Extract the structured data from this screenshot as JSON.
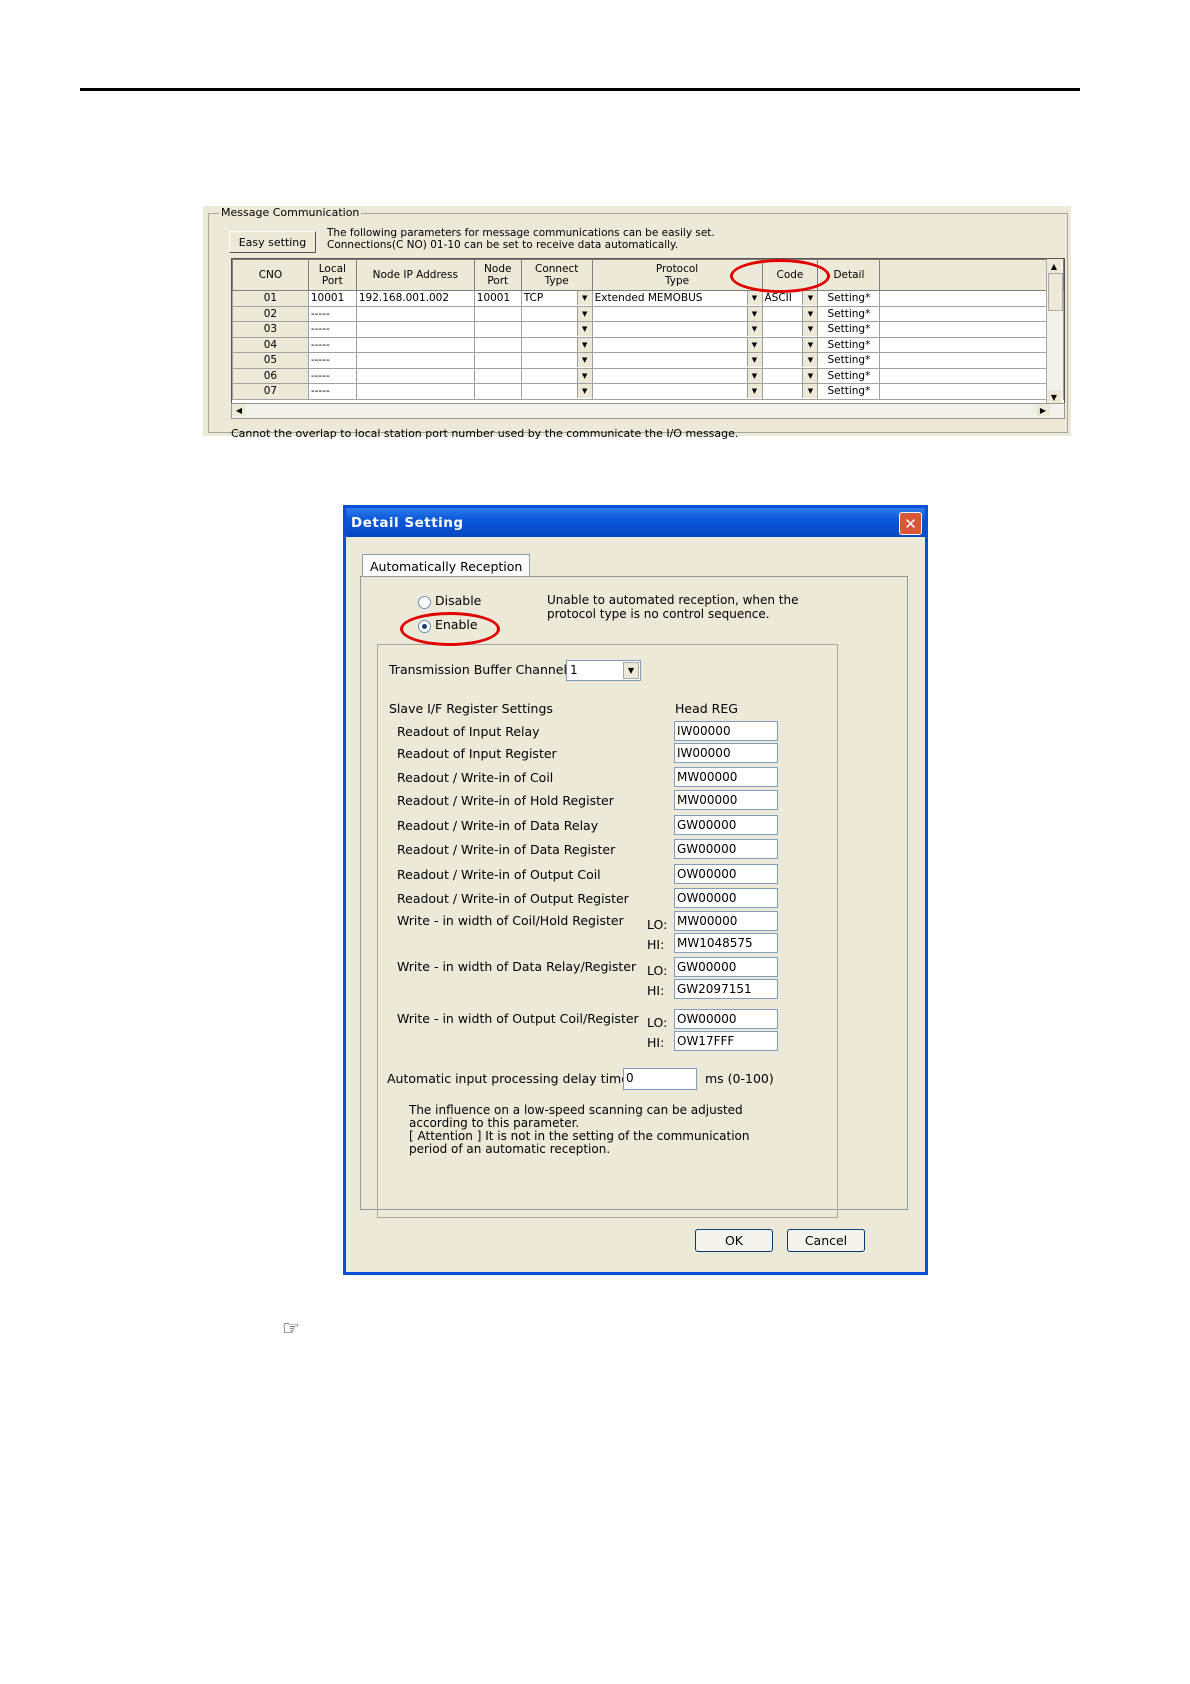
{
  "message_communication": {
    "group_title": "Message Communication",
    "easy_setting_label": "Easy setting",
    "info_line1": "The following parameters for message communications can be easily set.",
    "info_line2": "Connections(C NO) 01-10 can be set to receive data automatically.",
    "columns": [
      "CNO",
      "Local\nPort",
      "Node IP Address",
      "Node\nPort",
      "Connect\nType",
      "Protocol\nType",
      "Code",
      "Detail"
    ],
    "rows": [
      {
        "cno": "01",
        "local_port": "10001",
        "node_ip": "192.168.001.002",
        "node_port": "10001",
        "connect_type": "TCP",
        "protocol": "Extended MEMOBUS",
        "code": "ASCII",
        "detail": "Setting*"
      },
      {
        "cno": "02",
        "local_port": "-----",
        "node_ip": "",
        "node_port": "",
        "connect_type": "",
        "protocol": "",
        "code": "",
        "detail": "Setting*"
      },
      {
        "cno": "03",
        "local_port": "-----",
        "node_ip": "",
        "node_port": "",
        "connect_type": "",
        "protocol": "",
        "code": "",
        "detail": "Setting*"
      },
      {
        "cno": "04",
        "local_port": "-----",
        "node_ip": "",
        "node_port": "",
        "connect_type": "",
        "protocol": "",
        "code": "",
        "detail": "Setting*"
      },
      {
        "cno": "05",
        "local_port": "-----",
        "node_ip": "",
        "node_port": "",
        "connect_type": "",
        "protocol": "",
        "code": "",
        "detail": "Setting*"
      },
      {
        "cno": "06",
        "local_port": "-----",
        "node_ip": "",
        "node_port": "",
        "connect_type": "",
        "protocol": "",
        "code": "",
        "detail": "Setting*"
      },
      {
        "cno": "07",
        "local_port": "-----",
        "node_ip": "",
        "node_port": "",
        "connect_type": "",
        "protocol": "",
        "code": "",
        "detail": "Setting*"
      }
    ],
    "note": "Cannot the overlap to local station port number used by the communicate the  I/O message."
  },
  "dialog": {
    "title": "Detail Setting",
    "tab_label": "Automatically Reception",
    "disable_label": "Disable",
    "enable_label": "Enable",
    "enable_selected": true,
    "reception_note_line1": "Unable to automated reception, when the",
    "reception_note_line2": "protocol type is no control sequence.",
    "buffer_channel_label": "Transmission Buffer Channel",
    "buffer_channel_value": "1",
    "slave_header": "Slave I/F Register Settings",
    "head_reg_header": "Head REG",
    "registers": [
      {
        "label": "Readout of Input Relay",
        "value": "IW00000"
      },
      {
        "label": "Readout of Input Register",
        "value": "IW00000"
      },
      {
        "label": "Readout / Write-in of Coil",
        "value": "MW00000"
      },
      {
        "label": "Readout / Write-in of Hold Register",
        "value": "MW00000"
      },
      {
        "label": "Readout / Write-in of Data Relay",
        "value": "GW00000"
      },
      {
        "label": "Readout / Write-in of Data Register",
        "value": "GW00000"
      },
      {
        "label": "Readout / Write-in of Output Coil",
        "value": "OW00000"
      },
      {
        "label": "Readout / Write-in of Output Register",
        "value": "OW00000"
      }
    ],
    "widths": [
      {
        "label": "Write - in width of Coil/Hold Register",
        "lo": "MW00000",
        "hi": "MW1048575"
      },
      {
        "label": "Write - in width of Data Relay/Register",
        "lo": "GW00000",
        "hi": "GW2097151"
      },
      {
        "label": "Write - in width of Output Coil/Register",
        "lo": "OW00000",
        "hi": "OW17FFF"
      }
    ],
    "lo_label": "LO:",
    "hi_label": "HI:",
    "delay_label": "Automatic input processing delay time",
    "delay_value": "0",
    "delay_unit": "ms (0-100)",
    "note_line1": "The influence on a low-speed scanning can be adjusted",
    "note_line2": "according to this parameter.",
    "note_line3": "[ Attention ] It is not in the setting of the communication",
    "note_line4": "period of an automatic reception.",
    "ok_label": "OK",
    "cancel_label": "Cancel"
  },
  "annotation_colors": {
    "highlight_oval": "#e00000",
    "dialog_border": "#0a4fd8"
  },
  "icons": {
    "reference": "pointing-hand-icon"
  }
}
